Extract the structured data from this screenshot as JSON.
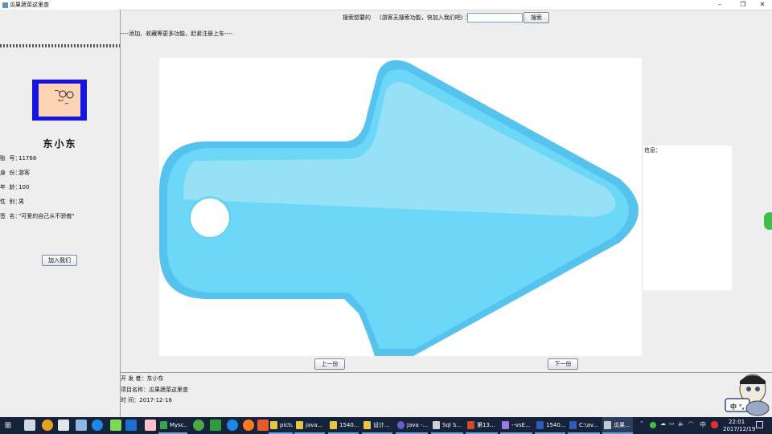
{
  "window": {
    "title": "瓜果蔬菜这里查",
    "minimize": "–",
    "maximize": "❐",
    "close": "✕"
  },
  "profile": {
    "name": "东小东",
    "lines": [
      {
        "label": "账",
        "label2": "号：",
        "value": "11768"
      },
      {
        "label": "身",
        "label2": "份：",
        "value": "游客"
      },
      {
        "label": "年",
        "label2": "龄：",
        "value": "100"
      },
      {
        "label": "性",
        "label2": "别：",
        "value": "男"
      },
      {
        "label": "签",
        "label2": "名：",
        "value": "\"可爱的自己从不骄傲\""
      }
    ],
    "join_button": "加入我们"
  },
  "search": {
    "label": "搜索想要的",
    "hint": "(游客无搜索功能，快加入我们吧) ：",
    "value": "",
    "button": "搜索"
  },
  "notice": "----添加、收藏等更多功能，赶紧注册上车----",
  "info": {
    "label": "信息："
  },
  "navigation": {
    "prev": "上一份",
    "next": "下一份"
  },
  "footer": {
    "developer_label": "开 发 者：",
    "developer": "东小东",
    "project_label": "项目名称：",
    "project": "瓜果蔬菜这里查",
    "time_label": "时      间：",
    "time": "2017-12-16"
  },
  "mascot": {
    "text": "中 °,"
  },
  "taskbar": {
    "apps": [
      {
        "label": "Mysc...",
        "icon_color": "#3aa64a"
      },
      {
        "label": "picture",
        "icon_color": "#e8c34a"
      },
      {
        "label": "java...",
        "icon_color": "#e8c34a"
      },
      {
        "label": "1540...",
        "icon_color": "#e8c34a"
      },
      {
        "label": "设计...",
        "icon_color": "#e8c34a"
      },
      {
        "label": "Java -...",
        "icon_color": "#6a5acd"
      },
      {
        "label": "Sql S...",
        "icon_color": "#d0d0d0"
      },
      {
        "label": "第13...",
        "icon_color": "#d04a2a"
      },
      {
        "label": "--vsE...",
        "icon_color": "#9a7ae0"
      },
      {
        "label": "1540...",
        "icon_color": "#2b5cb8"
      },
      {
        "label": "C:\\av...",
        "icon_color": "#2b5cb8"
      },
      {
        "label": "瓜果...",
        "icon_color": "#c0c8d0"
      }
    ],
    "ime": "中",
    "clock_time": "22:01",
    "clock_date": "2017/12/19"
  },
  "colors": {
    "avatar_bg": "#1515e0",
    "arrow_light": "#9fe3f7",
    "arrow_mid": "#6cd7f7",
    "arrow_dark": "#55c3ee"
  }
}
